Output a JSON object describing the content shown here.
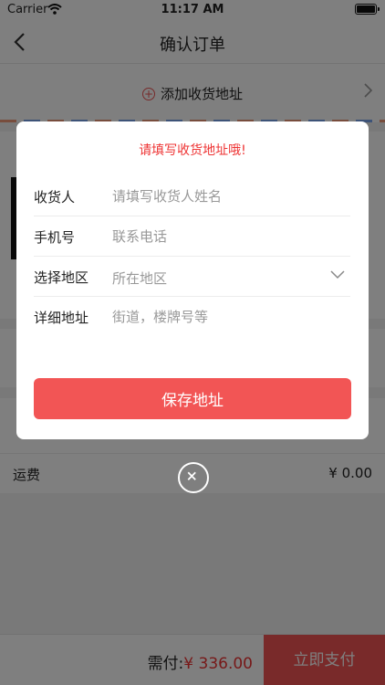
{
  "status_bar": {
    "carrier": "Carrier",
    "time": "11:17 AM"
  },
  "nav": {
    "title": "确认订单"
  },
  "address": {
    "add_label": "添加收货地址"
  },
  "shipping": {
    "label": "运费",
    "value": "¥ 0.00"
  },
  "bottom": {
    "total_label": "需付:",
    "total_amount": "¥ 336.00",
    "pay_label": "立即支付"
  },
  "modal": {
    "heading": "请填写收货地址哦!",
    "fields": [
      {
        "label": "收货人",
        "placeholder": "请填写收货人姓名"
      },
      {
        "label": "手机号",
        "placeholder": "联系电话"
      },
      {
        "label": "选择地区",
        "placeholder": "所在地区"
      },
      {
        "label": "详细地址",
        "placeholder": "街道，楼牌号等"
      }
    ],
    "save_label": "保存地址"
  },
  "colors": {
    "accent": "#f25555",
    "warning_text": "#e33333"
  }
}
